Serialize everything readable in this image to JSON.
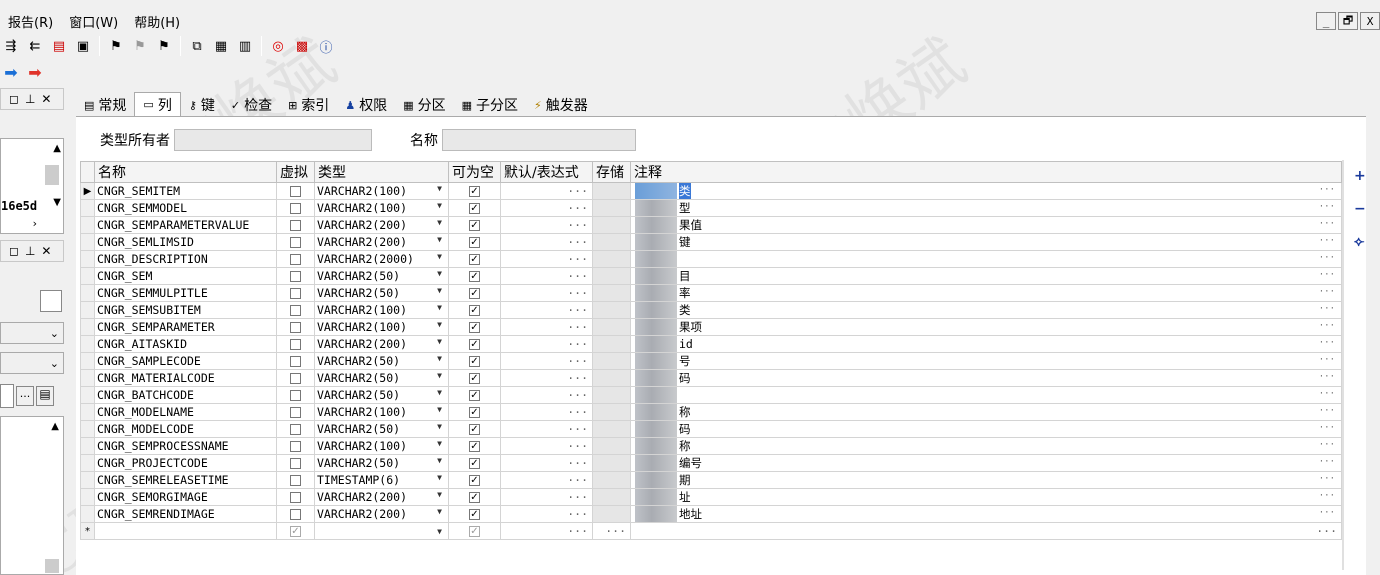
{
  "menu": [
    "报告(R)",
    "窗口(W)",
    "帮助(H)"
  ],
  "window_controls": [
    "_",
    "🗗",
    "X"
  ],
  "tabs": [
    {
      "label": "常规",
      "icon": "general-icon"
    },
    {
      "label": "列",
      "icon": "column-icon"
    },
    {
      "label": "键",
      "icon": "key-icon"
    },
    {
      "label": "检查",
      "icon": "check-icon"
    },
    {
      "label": "索引",
      "icon": "index-icon"
    },
    {
      "label": "权限",
      "icon": "privileges-icon"
    },
    {
      "label": "分区",
      "icon": "partition-icon"
    },
    {
      "label": "子分区",
      "icon": "subpartition-icon"
    },
    {
      "label": "触发器",
      "icon": "trigger-icon"
    }
  ],
  "form": {
    "type_owner_label": "类型所有者",
    "type_owner_value": "",
    "name_label": "名称",
    "name_value": ""
  },
  "left_panel": {
    "truncated_text": "16e5d",
    "dots_button": "..."
  },
  "grid": {
    "headers": [
      "名称",
      "虚拟",
      "类型",
      "可为空",
      "默认/表达式",
      "存储",
      "注释"
    ],
    "rows": [
      {
        "name": "CNGR_SEMITEM",
        "virtual": false,
        "type": "VARCHAR2(100)",
        "nullable": true,
        "comment": "类"
      },
      {
        "name": "CNGR_SEMMODEL",
        "virtual": false,
        "type": "VARCHAR2(100)",
        "nullable": true,
        "comment": "型"
      },
      {
        "name": "CNGR_SEMPARAMETERVALUE",
        "virtual": false,
        "type": "VARCHAR2(200)",
        "nullable": true,
        "comment": "果值"
      },
      {
        "name": "CNGR_SEMLIMSID",
        "virtual": false,
        "type": "VARCHAR2(200)",
        "nullable": true,
        "comment": "键"
      },
      {
        "name": "CNGR_DESCRIPTION",
        "virtual": false,
        "type": "VARCHAR2(2000)",
        "nullable": true,
        "comment": ""
      },
      {
        "name": "CNGR_SEM",
        "virtual": false,
        "type": "VARCHAR2(50)",
        "nullable": true,
        "comment": "目"
      },
      {
        "name": "CNGR_SEMMULPITLE",
        "virtual": false,
        "type": "VARCHAR2(50)",
        "nullable": true,
        "comment": "率"
      },
      {
        "name": "CNGR_SEMSUBITEM",
        "virtual": false,
        "type": "VARCHAR2(100)",
        "nullable": true,
        "comment": "类"
      },
      {
        "name": "CNGR_SEMPARAMETER",
        "virtual": false,
        "type": "VARCHAR2(100)",
        "nullable": true,
        "comment": "果项"
      },
      {
        "name": "CNGR_AITASKID",
        "virtual": false,
        "type": "VARCHAR2(200)",
        "nullable": true,
        "comment": "id"
      },
      {
        "name": "CNGR_SAMPLECODE",
        "virtual": false,
        "type": "VARCHAR2(50)",
        "nullable": true,
        "comment": "号"
      },
      {
        "name": "CNGR_MATERIALCODE",
        "virtual": false,
        "type": "VARCHAR2(50)",
        "nullable": true,
        "comment": "码"
      },
      {
        "name": "CNGR_BATCHCODE",
        "virtual": false,
        "type": "VARCHAR2(50)",
        "nullable": true,
        "comment": ""
      },
      {
        "name": "CNGR_MODELNAME",
        "virtual": false,
        "type": "VARCHAR2(100)",
        "nullable": true,
        "comment": "称"
      },
      {
        "name": "CNGR_MODELCODE",
        "virtual": false,
        "type": "VARCHAR2(50)",
        "nullable": true,
        "comment": "码"
      },
      {
        "name": "CNGR_SEMPROCESSNAME",
        "virtual": false,
        "type": "VARCHAR2(100)",
        "nullable": true,
        "comment": "称"
      },
      {
        "name": "CNGR_PROJECTCODE",
        "virtual": false,
        "type": "VARCHAR2(50)",
        "nullable": true,
        "comment": "编号"
      },
      {
        "name": "CNGR_SEMRELEASETIME",
        "virtual": false,
        "type": "TIMESTAMP(6)",
        "nullable": true,
        "comment": "期"
      },
      {
        "name": "CNGR_SEMORGIMAGE",
        "virtual": false,
        "type": "VARCHAR2(200)",
        "nullable": true,
        "comment": "址"
      },
      {
        "name": "CNGR_SEMRENDIMAGE",
        "virtual": false,
        "type": "VARCHAR2(200)",
        "nullable": true,
        "comment": "地址"
      }
    ],
    "new_row_marker": "*",
    "current_row_marker": "▶"
  },
  "right_controls": [
    "+",
    "−",
    "⟣"
  ],
  "watermark": {
    "text1": "向焕斌",
    "text2": "CNGR"
  }
}
